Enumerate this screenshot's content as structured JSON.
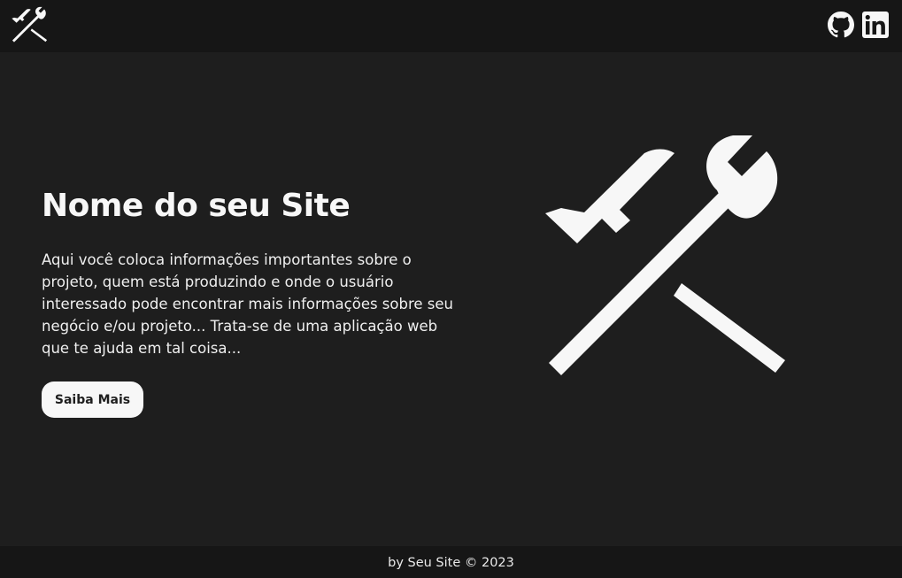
{
  "header": {
    "logo_icon": "tools-icon",
    "social": [
      {
        "icon": "github-icon"
      },
      {
        "icon": "linkedin-icon"
      }
    ]
  },
  "hero": {
    "title": "Nome do seu Site",
    "description": "Aqui você coloca informações importantes sobre o projeto, quem está produzindo e onde o usuário interessado pode encontrar mais informações sobre seu negócio e/ou projeto... Trata-se de uma aplicação web que te ajuda em tal coisa...",
    "button_label": "Saiba Mais",
    "illustration_icon": "tools-icon"
  },
  "footer": {
    "text": "by Seu Site © 2023"
  },
  "colors": {
    "background": "#1e1e1e",
    "bars": "#161616",
    "foreground": "#f7f7f7"
  }
}
